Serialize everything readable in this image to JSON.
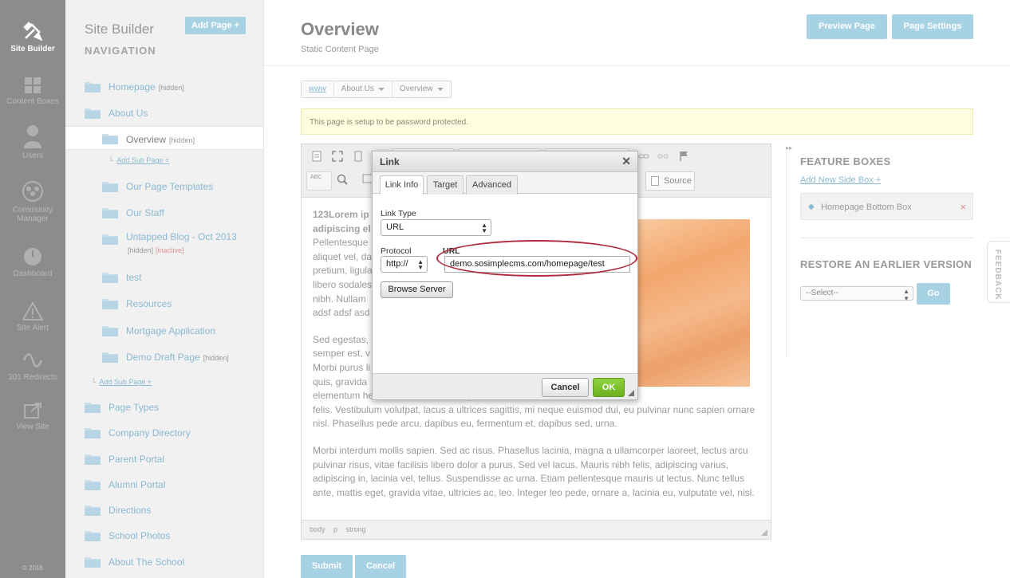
{
  "rail": {
    "items": [
      {
        "label": "Site Builder",
        "icon": "tools-icon"
      },
      {
        "label": "Content Boxes",
        "icon": "grid-icon"
      },
      {
        "label": "Users",
        "icon": "user-icon"
      },
      {
        "label": "Community Manager",
        "icon": "community-icon"
      },
      {
        "label": "Dashboard",
        "icon": "dashboard-icon"
      },
      {
        "label": "Site Alert",
        "icon": "alert-icon"
      },
      {
        "label": "301 Redirects",
        "icon": "redirect-icon"
      },
      {
        "label": "View Site",
        "icon": "external-link-icon"
      }
    ],
    "copyright": "© 2016"
  },
  "nav": {
    "title": "Site Builder",
    "subtitle": "NAVIGATION",
    "add_page": "Add Page +",
    "add_sub_page": "Add Sub Page +",
    "items": [
      {
        "label": "Homepage",
        "tag": "[hidden]"
      },
      {
        "label": "About Us",
        "tag": ""
      },
      {
        "label": "Overview",
        "tag": "[hidden]"
      },
      {
        "label": "Our Page Templates",
        "tag": ""
      },
      {
        "label": "Our Staff",
        "tag": ""
      },
      {
        "label": "Untapped Blog - Oct 2013",
        "tag": "[hidden]",
        "tag2": "[inactive]"
      },
      {
        "label": "test",
        "tag": ""
      },
      {
        "label": "Resources",
        "tag": ""
      },
      {
        "label": "Mortgage Application",
        "tag": ""
      },
      {
        "label": "Demo Draft Page",
        "tag": "[hidden]"
      },
      {
        "label": "Page Types",
        "tag": ""
      },
      {
        "label": "Company Directory",
        "tag": ""
      },
      {
        "label": "Parent Portal",
        "tag": ""
      },
      {
        "label": "Alumni Portal",
        "tag": ""
      },
      {
        "label": "Directions",
        "tag": ""
      },
      {
        "label": "School Photos",
        "tag": ""
      },
      {
        "label": "About The School",
        "tag": ""
      }
    ]
  },
  "header": {
    "title": "Overview",
    "subtitle": "Static Content Page",
    "preview": "Preview Page",
    "settings": "Page Settings"
  },
  "breadcrumb": [
    "www",
    "About Us",
    "Overview"
  ],
  "notice": "This page is setup to be password protected.",
  "editor": {
    "source_label": "Source",
    "lead_title": "123Lorem ip",
    "lead_title2": "adipiscing el",
    "p1_lines": [
      "Pellentesque",
      "aliquet vel, da",
      "pretium, ligula",
      "libero sodales",
      "nibh. Nullam",
      "adsf adsf asd"
    ],
    "p2_lines": [
      "Sed egestas,",
      "semper est, v",
      "Morbi purus li",
      "quis, gravida",
      "elementum hendrerit tortor. Sed semper lorem at"
    ],
    "p2_tail": "felis. Vestibulum volutpat, lacus a ultrices sagittis, mi neque euismod dui, eu pulvinar nunc sapien ornare nisl. Phasellus pede arcu, dapibus eu, fermentum et, dapibus sed, urna.",
    "p3": "Morbi interdum mollis sapien. Sed ac risus. Phasellus lacinia, magna a ullamcorper laoreet, lectus arcu pulvinar risus, vitae facilisis libero dolor a purus. Sed vel lacus. Mauris nibh felis, adipiscing varius, adipiscing in, lacinia vel, tellus. Suspendisse ac urna. Etiam pellentesque mauris ut lectus. Nunc tellus ante, mattis eget, gravida vitae, ultricies ac, leo. Integer leo pede, ornare a, lacinia eu, vulputate vel, nisl.",
    "status_path": [
      "body",
      "p",
      "strong"
    ]
  },
  "actions": {
    "submit": "Submit",
    "cancel": "Cancel"
  },
  "right": {
    "feature_title": "FEATURE BOXES",
    "add_side": "Add New Side Box +",
    "side_box": "Homepage Bottom Box",
    "restore_title": "RESTORE AN EARLIER VERSION",
    "restore_select": "--Select--",
    "go": "Go",
    "feedback": "FEEDBACK"
  },
  "dialog": {
    "title": "Link",
    "tabs": [
      "Link Info",
      "Target",
      "Advanced"
    ],
    "link_type_label": "Link Type",
    "link_type_value": "URL",
    "protocol_label": "Protocol",
    "protocol_value": "http://",
    "url_label": "URL",
    "url_value": "demo.sosimplecms.com/homepage/test",
    "browse": "Browse Server",
    "cancel": "Cancel",
    "ok": "OK"
  },
  "colors": {
    "accent": "#a6d2e4",
    "link": "#8ab9d2",
    "ok_green": "#7cc12e",
    "highlight_ring": "#b02a3b"
  }
}
